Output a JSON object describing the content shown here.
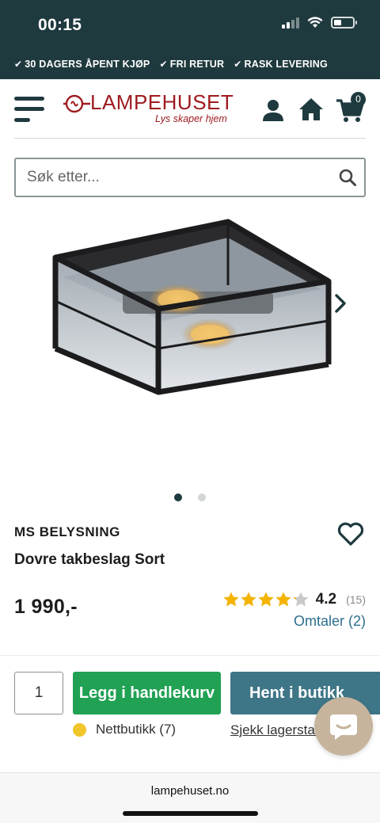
{
  "status_bar": {
    "time": "00:15"
  },
  "usp": [
    {
      "label": "30 DAGERS ÅPENT KJØP"
    },
    {
      "label": "FRI RETUR"
    },
    {
      "label": "RASK LEVERING"
    }
  ],
  "header": {
    "logo_text": "LAMPEHUSET",
    "logo_tagline": "Lys skaper hjem",
    "cart_count": "0"
  },
  "search": {
    "placeholder": "Søk etter..."
  },
  "gallery": {
    "slide_count": 2,
    "active_slide": 1
  },
  "product": {
    "brand": "MS BELYSNING",
    "name": "Dovre takbeslag Sort",
    "price": "1 990,-",
    "rating_value": "4.2",
    "rating_count": "(15)",
    "rating_stars": 4.2,
    "reviews_link": "Omtaler (2)"
  },
  "purchase": {
    "quantity": "1",
    "add_to_cart": "Legg i handlekurv",
    "pickup": "Hent i butikk",
    "stock_label": "Nettbutikk (7)",
    "stock_link": "Sjekk lagerstatus i butikk"
  },
  "browser": {
    "url": "lampehuset.no"
  },
  "colors": {
    "header_bg": "#1f3a3f",
    "brand_red": "#9e1b20",
    "add_to_cart": "#20a153",
    "pickup": "#3f7687",
    "link": "#2d6e8d",
    "star": "#f4b400",
    "stock_indicator": "#f0c62a"
  }
}
